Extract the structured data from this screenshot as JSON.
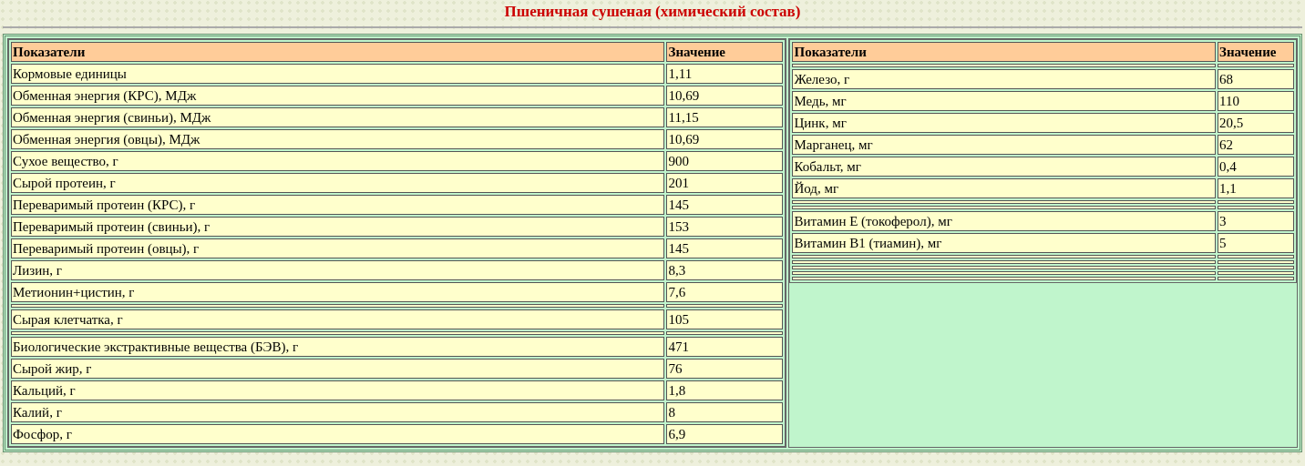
{
  "title": "Пшеничная сушеная (химический состав)",
  "tables": [
    {
      "columns": [
        "Показатели",
        "Значение"
      ],
      "rows": [
        {
          "kind": "data",
          "name": "Кормовые единицы",
          "value": "1,11"
        },
        {
          "kind": "data",
          "name": "Обменная энергия (КРС), МДж",
          "value": "10,69"
        },
        {
          "kind": "data",
          "name": "Обменная энергия (свиньи), МДж",
          "value": "11,15"
        },
        {
          "kind": "data",
          "name": "Обменная энергия (овцы), МДж",
          "value": "10,69"
        },
        {
          "kind": "data",
          "name": "Сухое вещество, г",
          "value": "900"
        },
        {
          "kind": "data",
          "name": "Сырой протеин, г",
          "value": "201"
        },
        {
          "kind": "data",
          "name": "Переваримый протеин (КРС), г",
          "value": "145"
        },
        {
          "kind": "data",
          "name": "Переваримый протеин (свиньи), г",
          "value": "153"
        },
        {
          "kind": "data",
          "name": "Переваримый протеин (овцы), г",
          "value": "145"
        },
        {
          "kind": "data",
          "name": "Лизин, г",
          "value": "8,3"
        },
        {
          "kind": "data",
          "name": "Метионин+цистин, г",
          "value": "7,6"
        },
        {
          "kind": "spacer"
        },
        {
          "kind": "data",
          "name": "Сырая клетчатка, г",
          "value": "105"
        },
        {
          "kind": "spacer"
        },
        {
          "kind": "data",
          "name": "Биологические экстрактивные вещества (БЭВ), г",
          "value": "471"
        },
        {
          "kind": "data",
          "name": "Сырой жир, г",
          "value": "76"
        },
        {
          "kind": "data",
          "name": "Кальций, г",
          "value": "1,8"
        },
        {
          "kind": "data",
          "name": "Калий, г",
          "value": "8"
        },
        {
          "kind": "data",
          "name": "Фосфор, г",
          "value": "6,9"
        }
      ]
    },
    {
      "columns": [
        "Показатели",
        "Значение"
      ],
      "rows": [
        {
          "kind": "spacer"
        },
        {
          "kind": "data",
          "name": "Железо, г",
          "value": "68"
        },
        {
          "kind": "data",
          "name": "Медь, мг",
          "value": "110"
        },
        {
          "kind": "data",
          "name": "Цинк, мг",
          "value": "20,5"
        },
        {
          "kind": "data",
          "name": "Марганец, мг",
          "value": "62"
        },
        {
          "kind": "data",
          "name": "Кобальт, мг",
          "value": "0,4"
        },
        {
          "kind": "data",
          "name": "Йод, мг",
          "value": "1,1"
        },
        {
          "kind": "spacer"
        },
        {
          "kind": "spacer"
        },
        {
          "kind": "data",
          "name": "Витамин Е (токоферол), мг",
          "value": "3"
        },
        {
          "kind": "data",
          "name": "Витамин В1 (тиамин), мг",
          "value": "5"
        },
        {
          "kind": "spacer"
        },
        {
          "kind": "spacer"
        },
        {
          "kind": "spacer"
        },
        {
          "kind": "spacer"
        },
        {
          "kind": "spacer"
        }
      ]
    }
  ]
}
